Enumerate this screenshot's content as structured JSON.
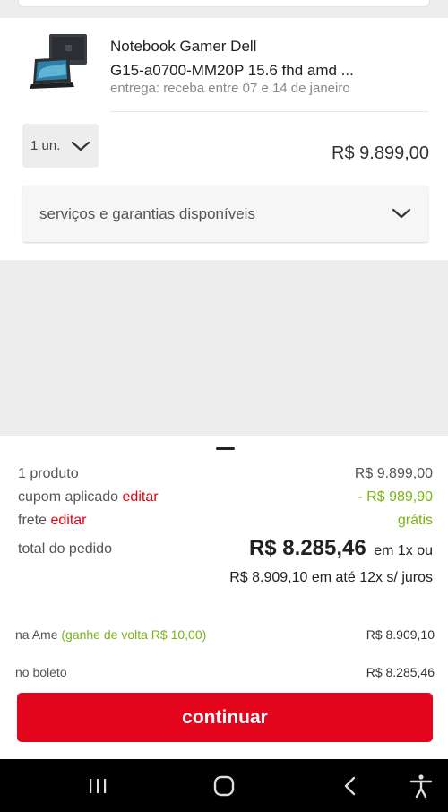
{
  "product": {
    "image_icon": "laptop-image",
    "title_line1": "Notebook Gamer Dell",
    "title_line2": "G15-a0700-MM20P 15.6 fhd amd ...",
    "delivery": "entrega: receba entre 07 e 14 de janeiro",
    "quantity_label": "1 un.",
    "price": "R$ 9.899,00",
    "services_label": "serviços e garantias disponíveis"
  },
  "summary": {
    "items_label": "1 produto",
    "items_value": "R$ 9.899,00",
    "coupon_label": "cupom aplicado",
    "coupon_edit": "editar",
    "coupon_value": "- R$ 989,90",
    "shipping_label": "frete",
    "shipping_edit": "editar",
    "shipping_value": "grátis",
    "total_label": "total do pedido",
    "total_value": "R$ 8.285,46",
    "total_suffix": "em 1x ou",
    "installments": "R$ 8.909,10 em até 12x s/ juros"
  },
  "payment": {
    "ame_label": "na Ame",
    "ame_cashback": "(ganhe de volta R$ 10,00)",
    "ame_value": "R$ 8.909,10",
    "boleto_label": "no boleto",
    "boleto_value": "R$ 8.285,46"
  },
  "actions": {
    "continue_label": "continuar"
  },
  "colors": {
    "accent_red": "#e3051b",
    "link_red": "#e60014",
    "discount_green": "#7ab317"
  },
  "navbar": {
    "icons": [
      "recent-apps-icon",
      "home-icon",
      "back-icon",
      "accessibility-icon"
    ]
  }
}
